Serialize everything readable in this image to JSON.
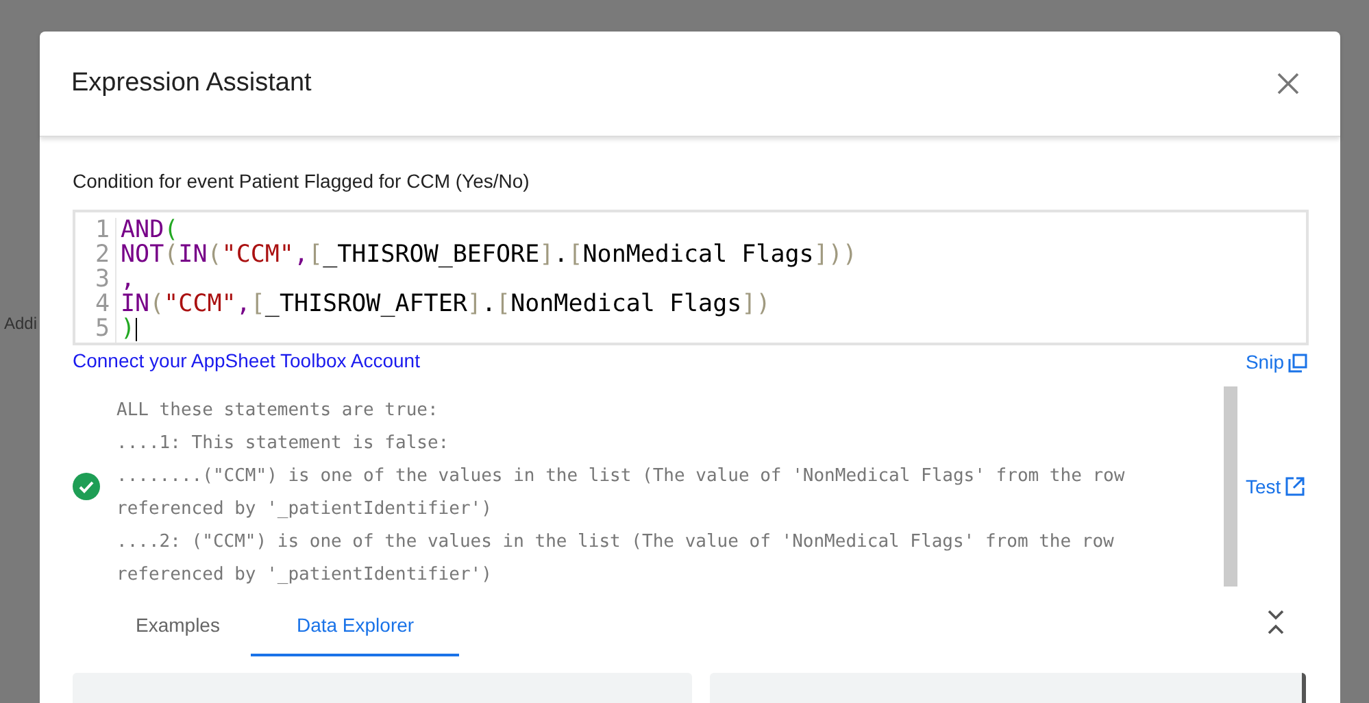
{
  "background": {
    "partial_text": "Addi"
  },
  "dialog": {
    "title": "Expression Assistant"
  },
  "condition_label": "Condition for event Patient Flagged for CCM (Yes/No)",
  "editor": {
    "lines": [
      {
        "number": "1",
        "tokens": [
          {
            "kind": "fn",
            "text": "AND"
          },
          {
            "kind": "paren-outer",
            "text": "("
          }
        ]
      },
      {
        "number": "2",
        "tokens": [
          {
            "kind": "fn",
            "text": "NOT"
          },
          {
            "kind": "paren",
            "text": "("
          },
          {
            "kind": "fn",
            "text": "IN"
          },
          {
            "kind": "paren",
            "text": "("
          },
          {
            "kind": "str",
            "text": "\"CCM\""
          },
          {
            "kind": "fn",
            "text": ","
          },
          {
            "kind": "bracket",
            "text": "["
          },
          {
            "kind": "text",
            "text": "_THISROW_BEFORE"
          },
          {
            "kind": "bracket",
            "text": "]"
          },
          {
            "kind": "text",
            "text": "."
          },
          {
            "kind": "bracket",
            "text": "["
          },
          {
            "kind": "text",
            "text": "NonMedical Flags"
          },
          {
            "kind": "bracket",
            "text": "]"
          },
          {
            "kind": "paren",
            "text": "))"
          }
        ]
      },
      {
        "number": "3",
        "tokens": [
          {
            "kind": "fn",
            "text": ","
          }
        ]
      },
      {
        "number": "4",
        "tokens": [
          {
            "kind": "fn",
            "text": "IN"
          },
          {
            "kind": "paren",
            "text": "("
          },
          {
            "kind": "str",
            "text": "\"CCM\""
          },
          {
            "kind": "fn",
            "text": ","
          },
          {
            "kind": "bracket",
            "text": "["
          },
          {
            "kind": "text",
            "text": "_THISROW_AFTER"
          },
          {
            "kind": "bracket",
            "text": "]"
          },
          {
            "kind": "text",
            "text": "."
          },
          {
            "kind": "bracket",
            "text": "["
          },
          {
            "kind": "text",
            "text": "NonMedical Flags"
          },
          {
            "kind": "bracket",
            "text": "]"
          },
          {
            "kind": "paren",
            "text": ")"
          }
        ]
      },
      {
        "number": "5",
        "tokens": [
          {
            "kind": "paren-outer",
            "text": ")"
          }
        ]
      }
    ]
  },
  "connect_link": "Connect your AppSheet Toolbox Account",
  "snip_link": "Snip",
  "result": {
    "valid": true,
    "lines": [
      "ALL these statements are true:",
      "....1: This statement is false:",
      "........(\"CCM\") is one of the values in the list (The value of 'NonMedical Flags' from the row referenced by '_patientIdentifier')",
      "....2: (\"CCM\") is one of the values in the list (The value of 'NonMedical Flags' from the row referenced by '_patientIdentifier')"
    ]
  },
  "test_link": "Test",
  "tabs": [
    {
      "label": "Examples",
      "selected": false
    },
    {
      "label": "Data Explorer",
      "selected": true
    }
  ]
}
